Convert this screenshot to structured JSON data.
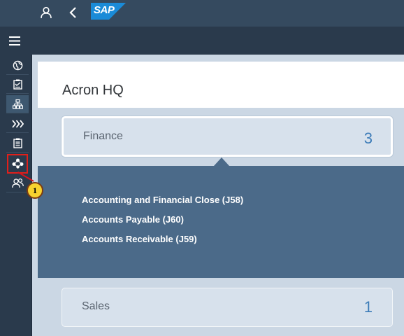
{
  "shell": {
    "logo_text": "SAP"
  },
  "nav_rail": {
    "items": [
      {
        "icon": "globe-icon"
      },
      {
        "icon": "checklist-icon"
      },
      {
        "icon": "org-chart-icon",
        "selected": true
      },
      {
        "icon": "chevrons-right-icon"
      },
      {
        "icon": "clipboard-icon"
      },
      {
        "icon": "connections-icon",
        "highlighted": true
      },
      {
        "icon": "users-icon"
      }
    ],
    "accent_color": "#e0201b"
  },
  "callout": {
    "number": "1"
  },
  "page": {
    "title": "Acron HQ"
  },
  "tiles": {
    "finance": {
      "label": "Finance",
      "count": "3"
    },
    "sales": {
      "label": "Sales",
      "count": "1"
    }
  },
  "finance_panel": {
    "links": [
      "Accounting and Financial Close (J58)",
      "Accounts Payable (J60)",
      "Accounts Receivable (J59)"
    ]
  },
  "colors": {
    "shell": "#354a5f",
    "panel": "#4b6a89",
    "tile": "#d7e1ec",
    "count": "#3d7cb8"
  }
}
